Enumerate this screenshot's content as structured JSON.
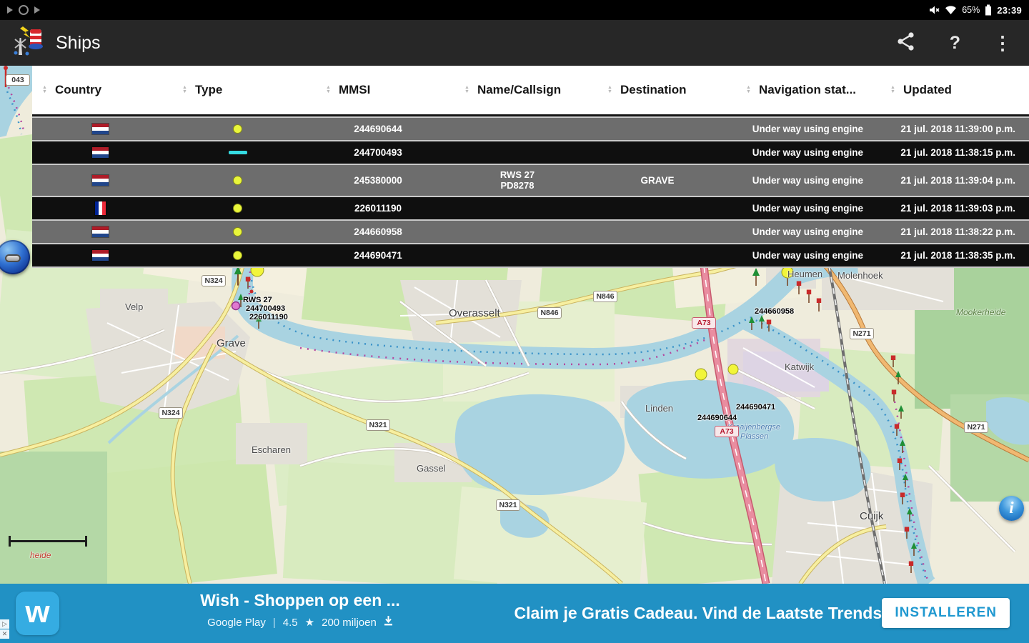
{
  "status_bar": {
    "time": "23:39",
    "battery_pct": "65%"
  },
  "app_bar": {
    "title": "Ships",
    "help_label": "?",
    "overflow_glyph": "⋮"
  },
  "table": {
    "columns": [
      "Country",
      "Type",
      "MMSI",
      "Name/Callsign",
      "Destination",
      "Navigation stat...",
      "Updated"
    ],
    "rows": [
      {
        "country": "nl",
        "type": "dot",
        "mmsi": "244690644",
        "name": "",
        "callsign": "",
        "destination": "",
        "nav_status": "Under way using engine",
        "updated": "21 jul. 2018 11:39:00 p.m."
      },
      {
        "country": "nl",
        "type": "dash",
        "mmsi": "244700493",
        "name": "",
        "callsign": "",
        "destination": "",
        "nav_status": "Under way using engine",
        "updated": "21 jul. 2018 11:38:15 p.m."
      },
      {
        "country": "nl",
        "type": "dot",
        "mmsi": "245380000",
        "name": "RWS 27",
        "callsign": "PD8278",
        "destination": "GRAVE",
        "nav_status": "Under way using engine",
        "updated": "21 jul. 2018 11:39:04 p.m."
      },
      {
        "country": "fr",
        "type": "dot",
        "mmsi": "226011190",
        "name": "",
        "callsign": "",
        "destination": "",
        "nav_status": "Under way using engine",
        "updated": "21 jul. 2018 11:39:03 p.m."
      },
      {
        "country": "nl",
        "type": "dot",
        "mmsi": "244660958",
        "name": "",
        "callsign": "",
        "destination": "",
        "nav_status": "Under way using engine",
        "updated": "21 jul. 2018 11:38:22 p.m."
      },
      {
        "country": "nl",
        "type": "dot",
        "mmsi": "244690471",
        "name": "",
        "callsign": "",
        "destination": "",
        "nav_status": "Under way using engine",
        "updated": "21 jul. 2018 11:38:35 p.m."
      }
    ]
  },
  "map": {
    "towns": {
      "velp": "Velp",
      "grave": "Grave",
      "overasselt": "Overasselt",
      "escharen": "Escharen",
      "gassel": "Gassel",
      "linden": "Linden",
      "katwijk": "Katwijk",
      "cuijk": "Cuijk",
      "molenhoek": "Molenhoek",
      "heumen": "Heumen",
      "mookerheide": "Mookerheide",
      "heide": "heide"
    },
    "shields": {
      "n324": "N324",
      "n321": "N321",
      "n846": "N846",
      "a73": "A73",
      "n271": "N271",
      "cut": "043"
    },
    "ship_labels": {
      "rws27": "RWS 27",
      "l244700493": "244700493",
      "l226011190": "226011190",
      "l244660958": "244660958",
      "l244690471": "244690471",
      "l244690644": "244690644"
    },
    "water_label_1": "Kraaijenbergse",
    "water_label_2": "Plassen",
    "info_glyph": "i"
  },
  "ad": {
    "title": "Wish - Shoppen op een ...",
    "store": "Google Play",
    "rating": "4.5",
    "star": "★",
    "installs": "200 miljoen",
    "claim": "Claim je Gratis Cadeau. Vind de Laatste Trends.",
    "cta": "INSTALLEREN",
    "logo_glyph": "w"
  },
  "colors": {
    "banner_blue": "#2191c4",
    "row_gray": "#6d6d6d",
    "row_dark": "#0f0f0f",
    "type_dot_yellow": "#e9f63b",
    "type_dash_cyan": "#35dbe2",
    "map_water": "#a9d3e1",
    "motorway_pink": "#e98da0"
  }
}
